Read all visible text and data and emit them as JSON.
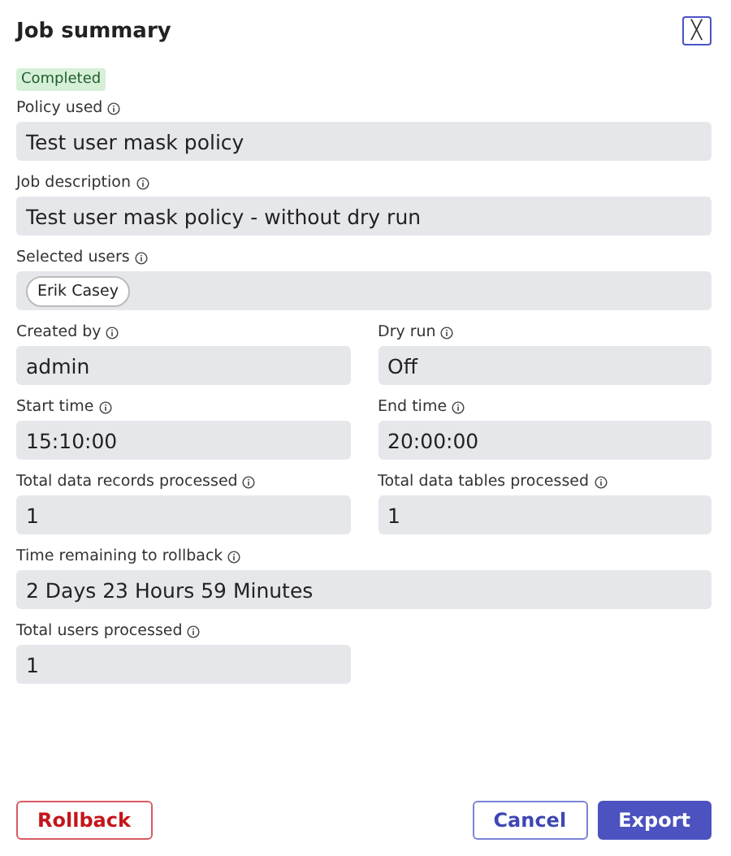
{
  "title": "Job summary",
  "close": {
    "label": "╳"
  },
  "status": "Completed",
  "rows": [
    {
      "fields": [
        {
          "kind": "wide",
          "label": "Policy used",
          "value": "Test user mask policy"
        }
      ]
    },
    {
      "fields": [
        {
          "kind": "wide",
          "label": "Job description",
          "value": "Test user mask policy - without dry run"
        }
      ]
    },
    {
      "fields": [
        {
          "kind": "chips",
          "label": "Selected users",
          "chips": [
            "Erik Casey"
          ]
        }
      ]
    },
    {
      "fields": [
        {
          "kind": "narrow",
          "label": "Created by",
          "value": "admin"
        },
        {
          "kind": "narrow",
          "label": "Dry run",
          "value": "Off"
        }
      ]
    },
    {
      "fields": [
        {
          "kind": "narrow",
          "label": "Start time",
          "value": "15:10:00"
        },
        {
          "kind": "narrow",
          "label": "End time",
          "value": "20:00:00"
        }
      ]
    },
    {
      "fields": [
        {
          "kind": "narrow",
          "label": "Total data records processed",
          "value": "1"
        },
        {
          "kind": "narrow",
          "label": "Total data tables processed",
          "value": "1"
        }
      ]
    },
    {
      "fields": [
        {
          "kind": "wide",
          "label": "Time remaining to rollback",
          "value": "2 Days 23 Hours 59 Minutes"
        }
      ]
    },
    {
      "fields": [
        {
          "kind": "narrow",
          "label": "Total users processed",
          "value": "1"
        }
      ]
    }
  ],
  "buttons": [
    {
      "kind": "danger",
      "label": "Rollback"
    },
    {
      "kind": "outline",
      "label": "Cancel"
    },
    {
      "kind": "primary",
      "label": "Export"
    }
  ]
}
